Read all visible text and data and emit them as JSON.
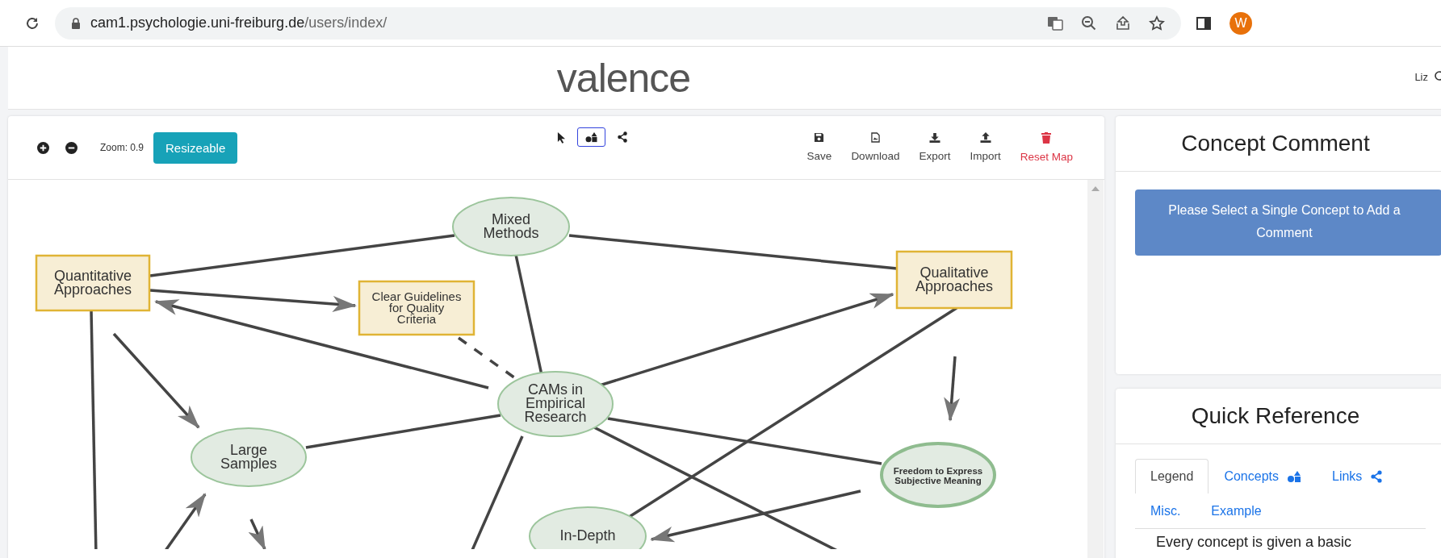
{
  "browser": {
    "url_host": "cam1.psychologie.uni-freiburg.de",
    "url_path": "/users/index/",
    "profile_initial": "W"
  },
  "header": {
    "logo": "valence",
    "user": "Liz"
  },
  "toolbar": {
    "zoom_label": "Zoom: 0.9",
    "resize_button": "Resizeable",
    "modes": [
      {
        "kind": "pointer",
        "selected": false
      },
      {
        "kind": "shapes",
        "selected": true
      },
      {
        "kind": "share",
        "selected": false
      }
    ],
    "actions": [
      {
        "kind": "save",
        "label": "Save"
      },
      {
        "kind": "download",
        "label": "Download"
      },
      {
        "kind": "export",
        "label": "Export"
      },
      {
        "kind": "import",
        "label": "Import"
      },
      {
        "kind": "reset",
        "label": "Reset Map"
      }
    ]
  },
  "map": {
    "nodes": [
      {
        "kind": "ellipse",
        "lines": [
          "Mixed",
          "Methods"
        ],
        "emphasized": false
      },
      {
        "kind": "rect",
        "lines": [
          "Quantitative",
          "Approaches"
        ],
        "emphasized": false
      },
      {
        "kind": "rect",
        "lines": [
          "Clear Guidelines",
          "for Quality",
          "Criteria"
        ],
        "emphasized": false
      },
      {
        "kind": "rect",
        "lines": [
          "Qualitative",
          "Approaches"
        ],
        "emphasized": false
      },
      {
        "kind": "ellipse",
        "lines": [
          "CAMs in",
          "Empirical",
          "Research"
        ],
        "emphasized": false
      },
      {
        "kind": "ellipse",
        "lines": [
          "Large",
          "Samples"
        ],
        "emphasized": false
      },
      {
        "kind": "ellipse",
        "lines": [
          "Freedom to Express",
          "Subjective Meaning"
        ],
        "emphasized": true
      },
      {
        "kind": "ellipse",
        "lines": [
          "In-Depth"
        ],
        "emphasized": false
      }
    ]
  },
  "comment_panel": {
    "title": "Concept Comment",
    "button": "Please Select a Single Concept to Add a Comment"
  },
  "reference_panel": {
    "title": "Quick Reference",
    "tabs": [
      {
        "label": "Legend",
        "selected": true
      },
      {
        "label": "Concepts",
        "selected": false
      },
      {
        "label": "Links",
        "selected": false
      },
      {
        "label": "Misc.",
        "selected": false
      },
      {
        "label": "Example",
        "selected": false
      }
    ],
    "text": "Every concept is given a basic"
  }
}
